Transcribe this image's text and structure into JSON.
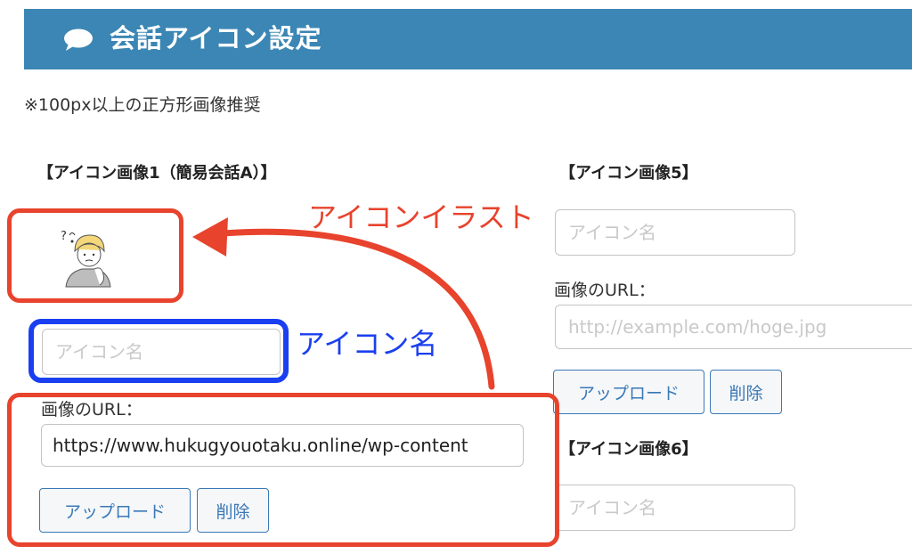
{
  "header": {
    "title": "会話アイコン設定",
    "icon": "speech-bubble-icon",
    "bg_color": "#3b86b4"
  },
  "note": "※100px以上の正方形画像推奨",
  "icon1": {
    "heading": "【アイコン画像1（簡易会話A）】",
    "name_placeholder": "アイコン名",
    "url_label": "画像のURL：",
    "url_value": "https://www.hukugyouotaku.online/wp-content",
    "upload_label": "アップロード",
    "delete_label": "削除",
    "image": "thinking-person-illustration"
  },
  "icon5": {
    "heading": "【アイコン画像5】",
    "name_placeholder": "アイコン名",
    "url_label": "画像のURL：",
    "url_placeholder": "http://example.com/hoge.jpg",
    "upload_label": "アップロード",
    "delete_label": "削除"
  },
  "icon6": {
    "heading": "【アイコン画像6】",
    "name_placeholder": "アイコン名"
  },
  "annotations": {
    "illustration_label": "アイコンイラスト",
    "name_label": "アイコン名",
    "red_color": "#e8432d",
    "blue_color": "#1a3ff0"
  }
}
